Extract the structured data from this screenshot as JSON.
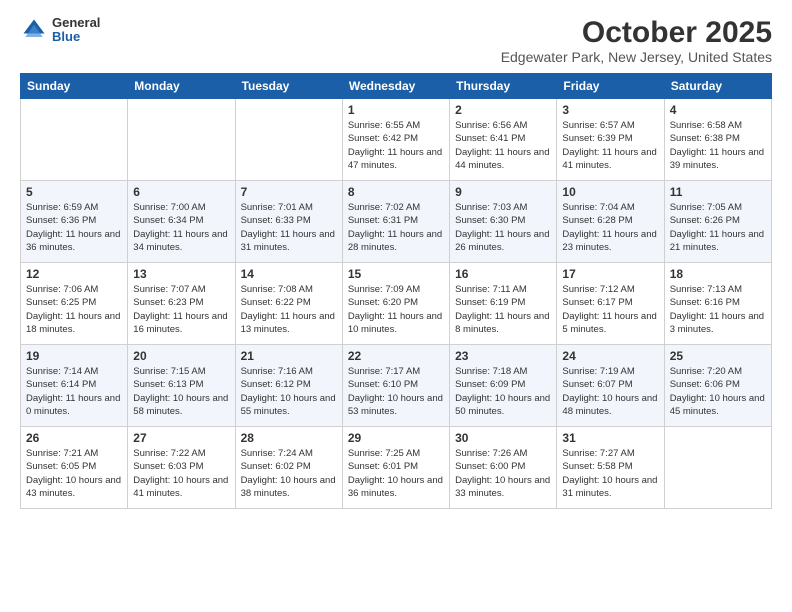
{
  "logo": {
    "general": "General",
    "blue": "Blue"
  },
  "title": "October 2025",
  "subtitle": "Edgewater Park, New Jersey, United States",
  "days_of_week": [
    "Sunday",
    "Monday",
    "Tuesday",
    "Wednesday",
    "Thursday",
    "Friday",
    "Saturday"
  ],
  "weeks": [
    [
      {
        "day": "",
        "info": ""
      },
      {
        "day": "",
        "info": ""
      },
      {
        "day": "",
        "info": ""
      },
      {
        "day": "1",
        "info": "Sunrise: 6:55 AM\nSunset: 6:42 PM\nDaylight: 11 hours and 47 minutes."
      },
      {
        "day": "2",
        "info": "Sunrise: 6:56 AM\nSunset: 6:41 PM\nDaylight: 11 hours and 44 minutes."
      },
      {
        "day": "3",
        "info": "Sunrise: 6:57 AM\nSunset: 6:39 PM\nDaylight: 11 hours and 41 minutes."
      },
      {
        "day": "4",
        "info": "Sunrise: 6:58 AM\nSunset: 6:38 PM\nDaylight: 11 hours and 39 minutes."
      }
    ],
    [
      {
        "day": "5",
        "info": "Sunrise: 6:59 AM\nSunset: 6:36 PM\nDaylight: 11 hours and 36 minutes."
      },
      {
        "day": "6",
        "info": "Sunrise: 7:00 AM\nSunset: 6:34 PM\nDaylight: 11 hours and 34 minutes."
      },
      {
        "day": "7",
        "info": "Sunrise: 7:01 AM\nSunset: 6:33 PM\nDaylight: 11 hours and 31 minutes."
      },
      {
        "day": "8",
        "info": "Sunrise: 7:02 AM\nSunset: 6:31 PM\nDaylight: 11 hours and 28 minutes."
      },
      {
        "day": "9",
        "info": "Sunrise: 7:03 AM\nSunset: 6:30 PM\nDaylight: 11 hours and 26 minutes."
      },
      {
        "day": "10",
        "info": "Sunrise: 7:04 AM\nSunset: 6:28 PM\nDaylight: 11 hours and 23 minutes."
      },
      {
        "day": "11",
        "info": "Sunrise: 7:05 AM\nSunset: 6:26 PM\nDaylight: 11 hours and 21 minutes."
      }
    ],
    [
      {
        "day": "12",
        "info": "Sunrise: 7:06 AM\nSunset: 6:25 PM\nDaylight: 11 hours and 18 minutes."
      },
      {
        "day": "13",
        "info": "Sunrise: 7:07 AM\nSunset: 6:23 PM\nDaylight: 11 hours and 16 minutes."
      },
      {
        "day": "14",
        "info": "Sunrise: 7:08 AM\nSunset: 6:22 PM\nDaylight: 11 hours and 13 minutes."
      },
      {
        "day": "15",
        "info": "Sunrise: 7:09 AM\nSunset: 6:20 PM\nDaylight: 11 hours and 10 minutes."
      },
      {
        "day": "16",
        "info": "Sunrise: 7:11 AM\nSunset: 6:19 PM\nDaylight: 11 hours and 8 minutes."
      },
      {
        "day": "17",
        "info": "Sunrise: 7:12 AM\nSunset: 6:17 PM\nDaylight: 11 hours and 5 minutes."
      },
      {
        "day": "18",
        "info": "Sunrise: 7:13 AM\nSunset: 6:16 PM\nDaylight: 11 hours and 3 minutes."
      }
    ],
    [
      {
        "day": "19",
        "info": "Sunrise: 7:14 AM\nSunset: 6:14 PM\nDaylight: 11 hours and 0 minutes."
      },
      {
        "day": "20",
        "info": "Sunrise: 7:15 AM\nSunset: 6:13 PM\nDaylight: 10 hours and 58 minutes."
      },
      {
        "day": "21",
        "info": "Sunrise: 7:16 AM\nSunset: 6:12 PM\nDaylight: 10 hours and 55 minutes."
      },
      {
        "day": "22",
        "info": "Sunrise: 7:17 AM\nSunset: 6:10 PM\nDaylight: 10 hours and 53 minutes."
      },
      {
        "day": "23",
        "info": "Sunrise: 7:18 AM\nSunset: 6:09 PM\nDaylight: 10 hours and 50 minutes."
      },
      {
        "day": "24",
        "info": "Sunrise: 7:19 AM\nSunset: 6:07 PM\nDaylight: 10 hours and 48 minutes."
      },
      {
        "day": "25",
        "info": "Sunrise: 7:20 AM\nSunset: 6:06 PM\nDaylight: 10 hours and 45 minutes."
      }
    ],
    [
      {
        "day": "26",
        "info": "Sunrise: 7:21 AM\nSunset: 6:05 PM\nDaylight: 10 hours and 43 minutes."
      },
      {
        "day": "27",
        "info": "Sunrise: 7:22 AM\nSunset: 6:03 PM\nDaylight: 10 hours and 41 minutes."
      },
      {
        "day": "28",
        "info": "Sunrise: 7:24 AM\nSunset: 6:02 PM\nDaylight: 10 hours and 38 minutes."
      },
      {
        "day": "29",
        "info": "Sunrise: 7:25 AM\nSunset: 6:01 PM\nDaylight: 10 hours and 36 minutes."
      },
      {
        "day": "30",
        "info": "Sunrise: 7:26 AM\nSunset: 6:00 PM\nDaylight: 10 hours and 33 minutes."
      },
      {
        "day": "31",
        "info": "Sunrise: 7:27 AM\nSunset: 5:58 PM\nDaylight: 10 hours and 31 minutes."
      },
      {
        "day": "",
        "info": ""
      }
    ]
  ]
}
